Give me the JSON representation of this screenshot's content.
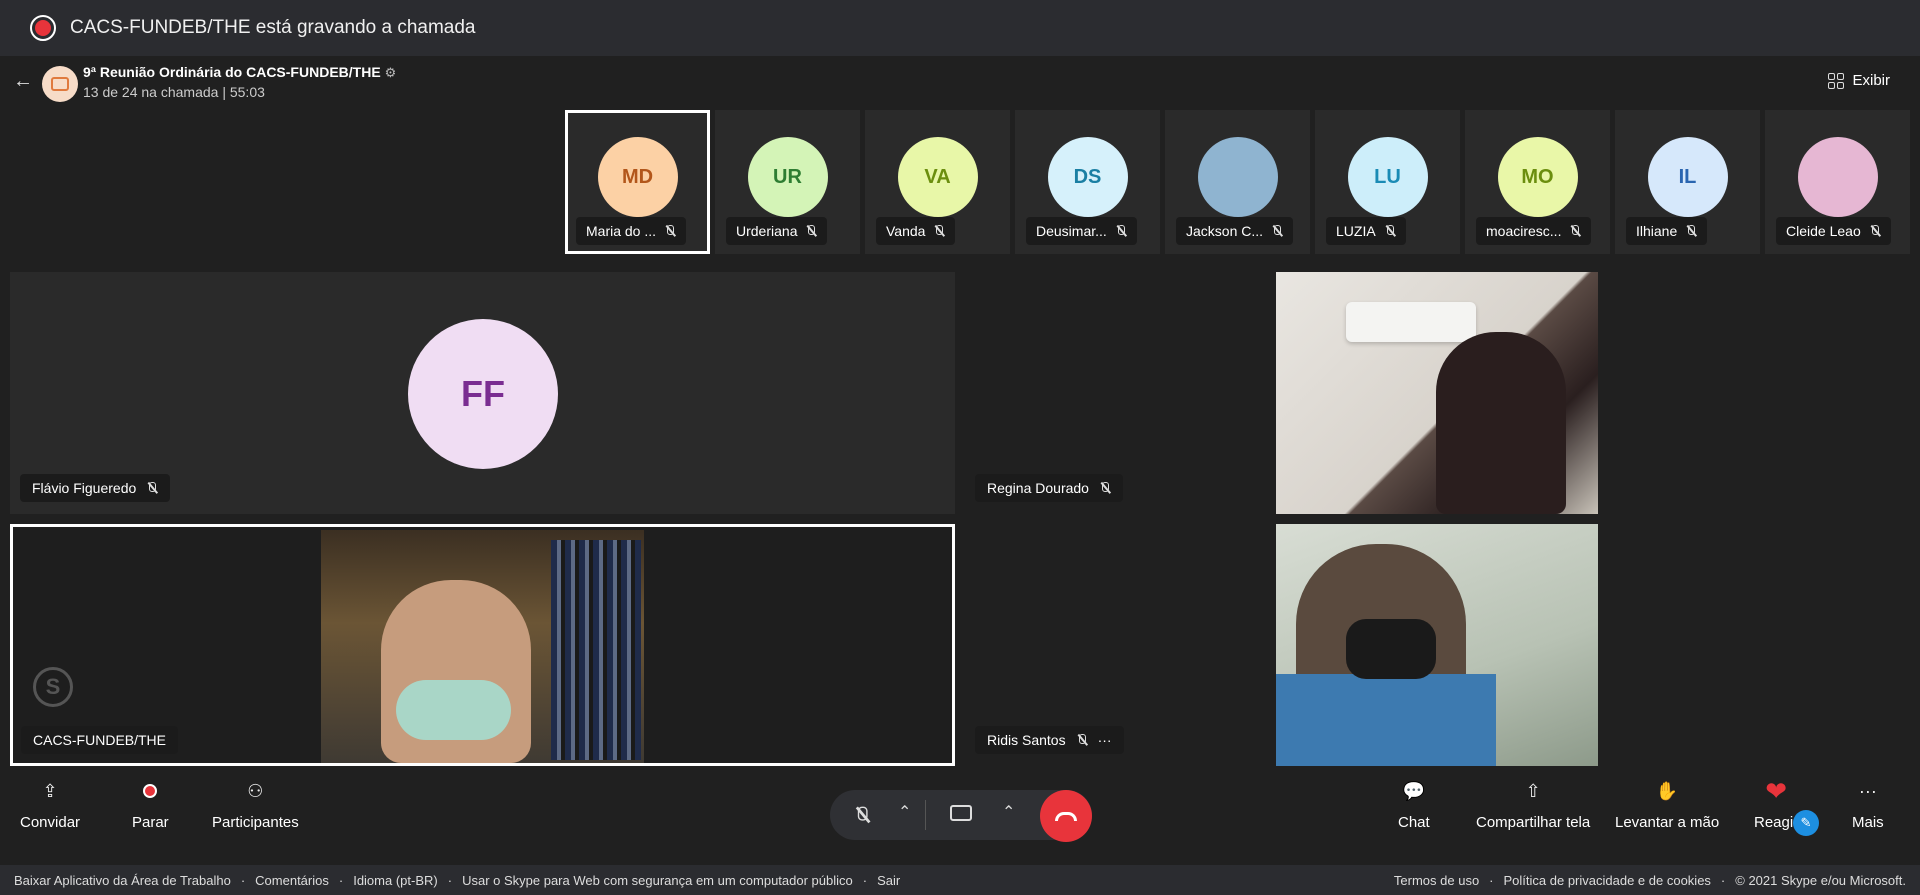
{
  "recording": {
    "text": "CACS-FUNDEB/THE está gravando a chamada"
  },
  "header": {
    "title": "9ª Reunião Ordinária do CACS-FUNDEB/THE",
    "subtitle": "13 de 24 na chamada | 55:03",
    "view_label": "Exibir"
  },
  "strip": [
    {
      "initials": "MD",
      "name": "Maria do ...",
      "bg": "#fcd1a5",
      "fg": "#b2561a"
    },
    {
      "initials": "UR",
      "name": "Urderiana",
      "bg": "#d4f4b7",
      "fg": "#2e7d32"
    },
    {
      "initials": "VA",
      "name": "Vanda",
      "bg": "#e8f7a8",
      "fg": "#6b8e0e"
    },
    {
      "initials": "DS",
      "name": "Deusimar...",
      "bg": "#d6f1fb",
      "fg": "#1a7fa3"
    },
    {
      "initials": "",
      "name": "Jackson C...",
      "bg": "#8fb4d0",
      "fg": "#fff"
    },
    {
      "initials": "LU",
      "name": "LUZIA",
      "bg": "#cdeefa",
      "fg": "#1a8bb5"
    },
    {
      "initials": "MO",
      "name": "moaciresc...",
      "bg": "#e9f7a8",
      "fg": "#6b8e0e"
    },
    {
      "initials": "IL",
      "name": "Ilhiane",
      "bg": "#d6e8fb",
      "fg": "#2a65b0"
    },
    {
      "initials": "",
      "name": "Cleide Leao",
      "bg": "#e6b7d3",
      "fg": "#fff"
    }
  ],
  "main": {
    "ff_initials": "FF",
    "ff_name": "Flávio Figueredo",
    "regina_name": "Regina Dourado",
    "cacs_name": "CACS-FUNDEB/THE",
    "ridis_name": "Ridis Santos",
    "more": "···"
  },
  "controls": {
    "convidar": "Convidar",
    "parar": "Parar",
    "participantes": "Participantes",
    "chat": "Chat",
    "compartilhar": "Compartilhar tela",
    "levantar": "Levantar a mão",
    "reagir": "Reagir",
    "mais": "Mais"
  },
  "footer": {
    "left": [
      "Baixar Aplicativo da Área de Trabalho",
      "Comentários",
      "Idioma (pt-BR)",
      "Usar o Skype para Web com segurança em um computador público",
      "Sair"
    ],
    "right": [
      "Termos de uso",
      "Política de privacidade e de cookies",
      "© 2021 Skype e/ou Microsoft."
    ]
  }
}
